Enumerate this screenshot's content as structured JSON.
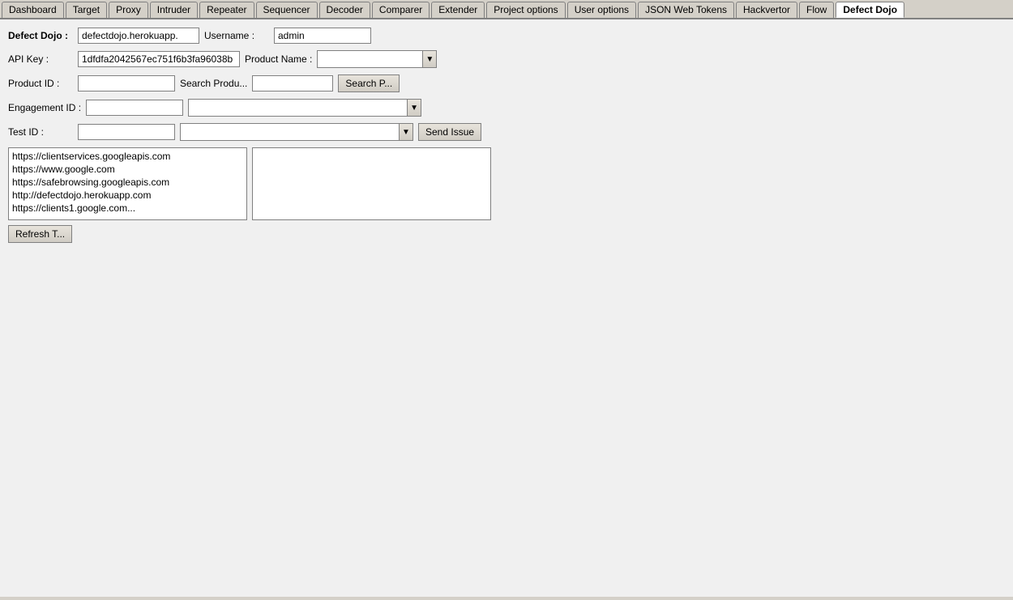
{
  "tabs": [
    {
      "id": "dashboard",
      "label": "Dashboard",
      "active": false
    },
    {
      "id": "target",
      "label": "Target",
      "active": false
    },
    {
      "id": "proxy",
      "label": "Proxy",
      "active": false
    },
    {
      "id": "intruder",
      "label": "Intruder",
      "active": false
    },
    {
      "id": "repeater",
      "label": "Repeater",
      "active": false
    },
    {
      "id": "sequencer",
      "label": "Sequencer",
      "active": false
    },
    {
      "id": "decoder",
      "label": "Decoder",
      "active": false
    },
    {
      "id": "comparer",
      "label": "Comparer",
      "active": false
    },
    {
      "id": "extender",
      "label": "Extender",
      "active": false
    },
    {
      "id": "project-options",
      "label": "Project options",
      "active": false
    },
    {
      "id": "user-options",
      "label": "User options",
      "active": false
    },
    {
      "id": "json-web-tokens",
      "label": "JSON Web Tokens",
      "active": false
    },
    {
      "id": "hackvertor",
      "label": "Hackvertor",
      "active": false
    },
    {
      "id": "flow",
      "label": "Flow",
      "active": false
    },
    {
      "id": "defect-dojo",
      "label": "Defect Dojo",
      "active": true
    }
  ],
  "form": {
    "defect_dojo_label": "Defect Dojo :",
    "defect_dojo_url": "defectdojo.herokuapp.",
    "username_label": "Username :",
    "username_value": "admin",
    "api_key_label": "API Key :",
    "api_key_value": "1dfdfa2042567ec751f6b3fa96038b",
    "product_name_label": "Product Name :",
    "product_id_label": "Product ID :",
    "search_product_label": "Search Produ...",
    "search_product_button": "Search P...",
    "engagement_id_label": "Engagement ID :",
    "test_id_label": "Test ID :",
    "send_issue_button": "Send Issue",
    "refresh_button": "Refresh T..."
  },
  "url_list": [
    "https://clientservices.googleapis.com",
    "https://www.google.com",
    "https://safebrowsing.googleapis.com",
    "http://defectdojo.herokuapp.com",
    "https://clients1.google.com..."
  ],
  "colors": {
    "tab_bg": "#d4d0c8",
    "active_tab_bg": "#ffffff",
    "content_bg": "#f0f0f0",
    "input_border": "#808080"
  }
}
